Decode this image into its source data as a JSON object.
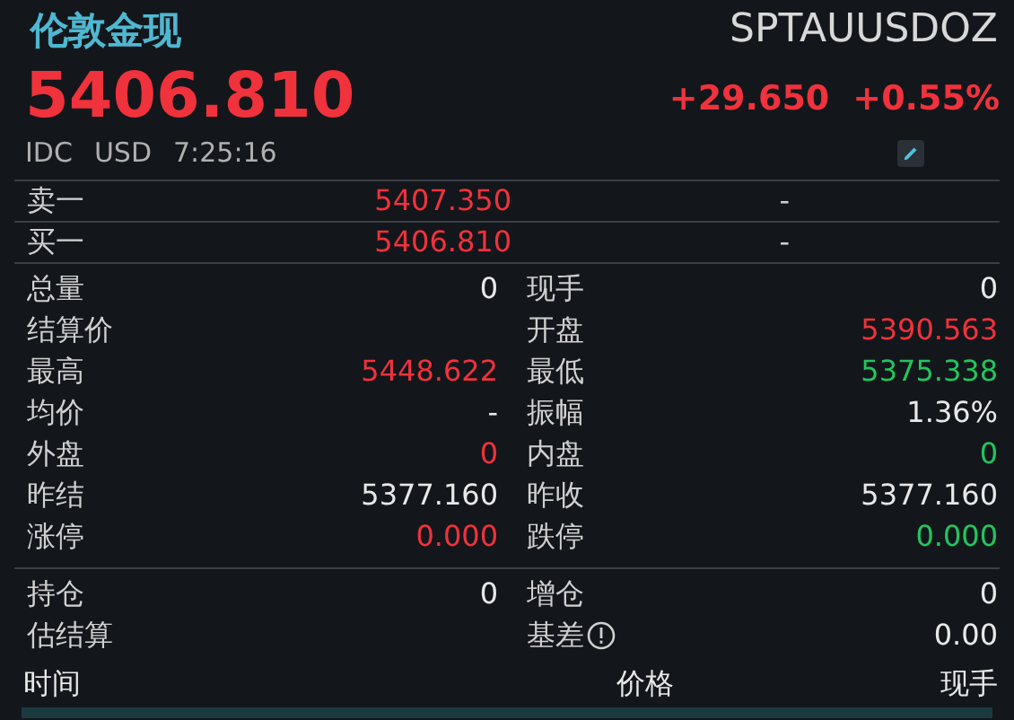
{
  "header": {
    "name": "伦敦金现",
    "code": "SPTAUUSDOZ",
    "price": "5406.810",
    "change": "+29.650",
    "change_pct": "+0.55%",
    "exchange": "IDC",
    "currency": "USD",
    "time": "7:25:16"
  },
  "orders": [
    {
      "label": "卖一",
      "price": "5407.350",
      "color": "#f0323c",
      "volume": "-"
    },
    {
      "label": "买一",
      "price": "5406.810",
      "color": "#f0323c",
      "volume": "-"
    }
  ],
  "stats": [
    {
      "label": "总量",
      "value": "0",
      "color": "#e8e8e8"
    },
    {
      "label": "现手",
      "value": "0",
      "color": "#e8e8e8"
    },
    {
      "label": "结算价"
    },
    {
      "label": "开盘",
      "value": "5390.563",
      "color": "#f0323c"
    },
    {
      "label": "最高",
      "value": "5448.622",
      "color": "#f0323c"
    },
    {
      "label": "最低",
      "value": "5375.338",
      "color": "#22c55e"
    },
    {
      "label": "均价",
      "value": "-",
      "color": "#e8e8e8"
    },
    {
      "label": "振幅",
      "value": "1.36%",
      "color": "#e8e8e8"
    },
    {
      "label": "外盘",
      "value": "0",
      "color": "#f0323c"
    },
    {
      "label": "内盘",
      "value": "0",
      "color": "#22c55e"
    },
    {
      "label": "昨结",
      "value": "5377.160",
      "color": "#e8e8e8"
    },
    {
      "label": "昨收",
      "value": "5377.160",
      "color": "#e8e8e8"
    },
    {
      "label": "涨停",
      "value": "0.000",
      "color": "#f0323c"
    },
    {
      "label": "跌停",
      "value": "0.000",
      "color": "#22c55e"
    }
  ],
  "positions": [
    {
      "label": "持仓",
      "value": "0",
      "color": "#e8e8e8",
      "info": false
    },
    {
      "label": "增仓",
      "value": "0",
      "color": "#e8e8e8",
      "info": false
    },
    {
      "label": "估结算",
      "info": false
    },
    {
      "label": "基差",
      "value": "0.00",
      "color": "#e8e8e8",
      "info": true
    }
  ],
  "trades_table": {
    "columns": [
      "时间",
      "价格",
      "现手"
    ]
  }
}
